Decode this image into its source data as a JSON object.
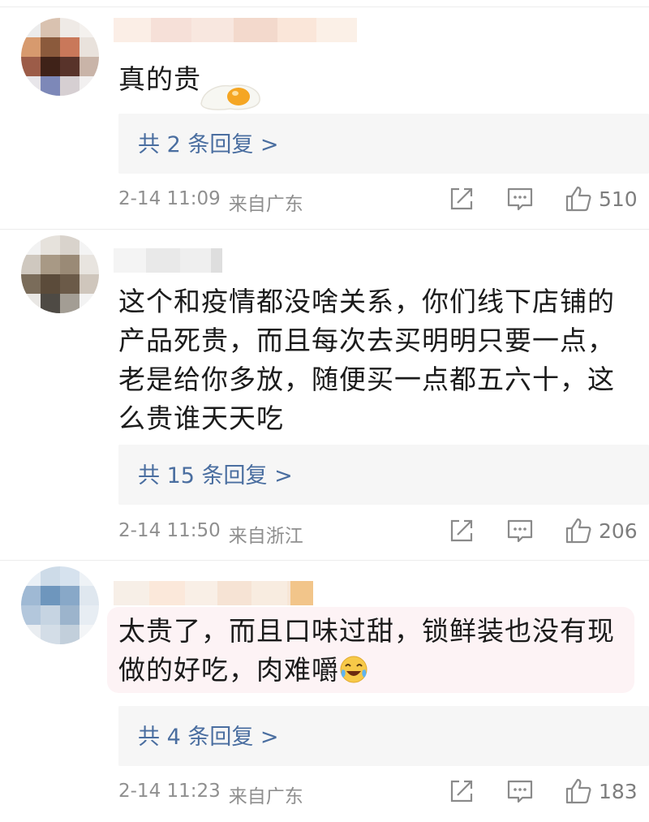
{
  "comments": [
    {
      "text_lines": [
        "真的贵"
      ],
      "reply_summary": "共 2 条回复 >",
      "time": "2-14 11:09",
      "location": "来自广东",
      "likes": "510",
      "emoji": "fried-egg"
    },
    {
      "text_lines": [
        "这个和疫情都没啥关系，你们线下店铺的",
        "产品死贵，而且每次去买明明只要一点，",
        "老是给你多放，随便买一点都五六十，这",
        "么贵谁天天吃"
      ],
      "reply_summary": "共 15 条回复 >",
      "time": "2-14 11:50",
      "location": "来自浙江",
      "likes": "206"
    },
    {
      "text_lines": [
        "太贵了，而且口味过甜，锁鲜装也没有现",
        "做的好吃，肉难嚼"
      ],
      "reply_summary": "共 4 条回复 >",
      "time": "2-14 11:23",
      "location": "来自广东",
      "likes": "183",
      "emoji": "laughing-crying"
    }
  ],
  "icons": {
    "share": "share-icon",
    "comment": "comment-icon",
    "like": "thumbs-up-icon"
  },
  "colors": {
    "link_blue": "#4a6ea0",
    "meta_gray": "#8f8f8f",
    "reply_bg": "#f6f6f6"
  }
}
